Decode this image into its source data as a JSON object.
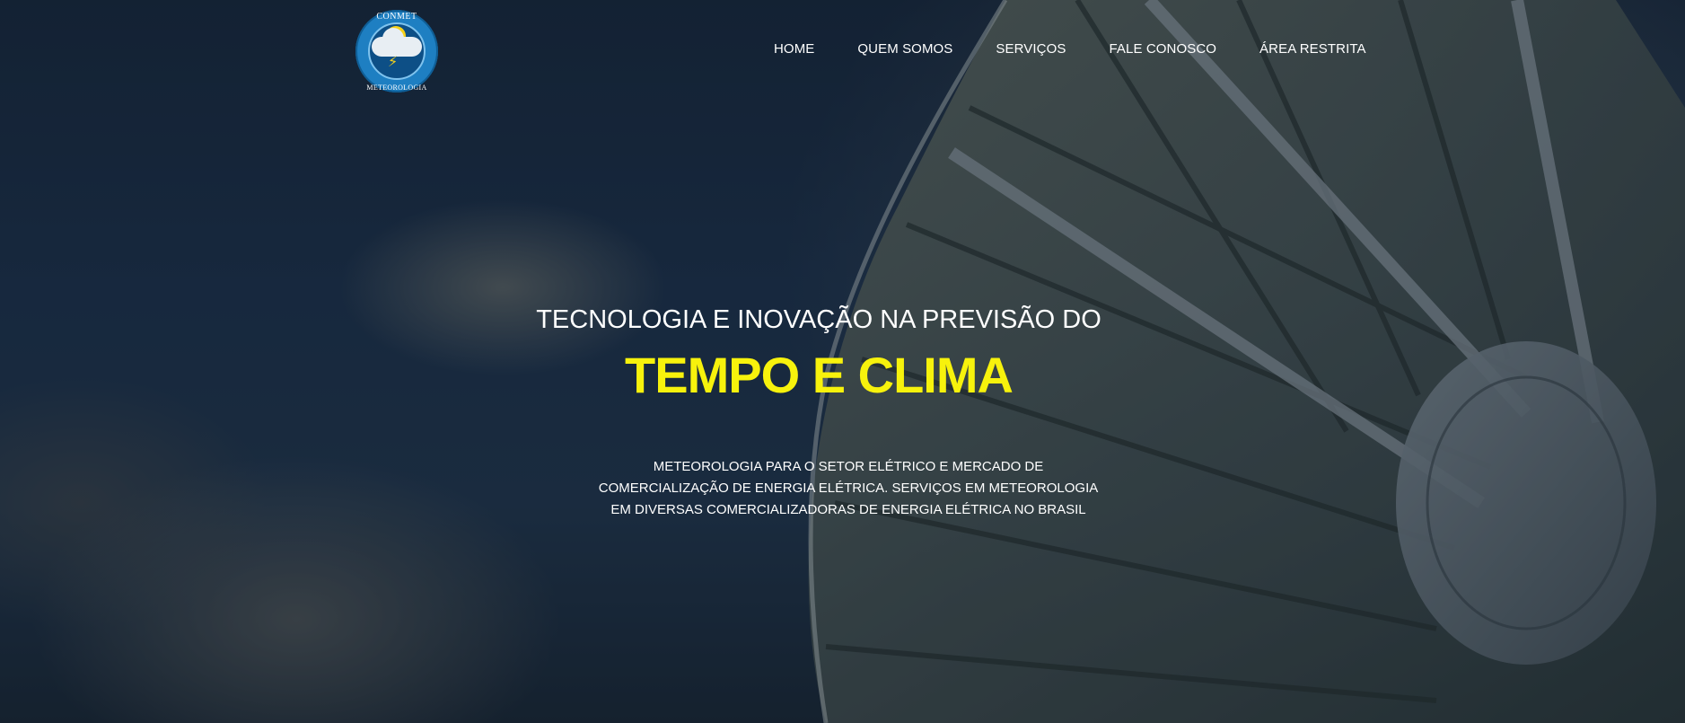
{
  "brand": {
    "logo_top_text": "CONMET",
    "logo_bottom_text": "METEOROLOGIA",
    "logo_icon": "cloud-sun-lightning-icon"
  },
  "nav": {
    "items": [
      {
        "label": "HOME"
      },
      {
        "label": "QUEM SOMOS"
      },
      {
        "label": "SERVIÇOS"
      },
      {
        "label": "FALE CONOSCO"
      },
      {
        "label": "ÁREA RESTRITA"
      }
    ]
  },
  "hero": {
    "pre_title": "TECNOLOGIA E INOVAÇÃO NA PREVISÃO DO",
    "title": "TEMPO E CLIMA",
    "description": "METEOROLOGIA PARA O SETOR ELÉTRICO E MERCADO DE COMERCIALIZAÇÃO DE ENERGIA ELÉTRICA. SERVIÇOS EM METEOROLOGIA EM DIVERSAS COMERCIALIZADORAS DE ENERGIA ELÉTRICA NO BRASIL",
    "background_icon": "satellite-dish-image"
  },
  "colors": {
    "accent": "#f7f20c",
    "text": "#ffffff",
    "logo_blue": "#1e7fc2"
  }
}
